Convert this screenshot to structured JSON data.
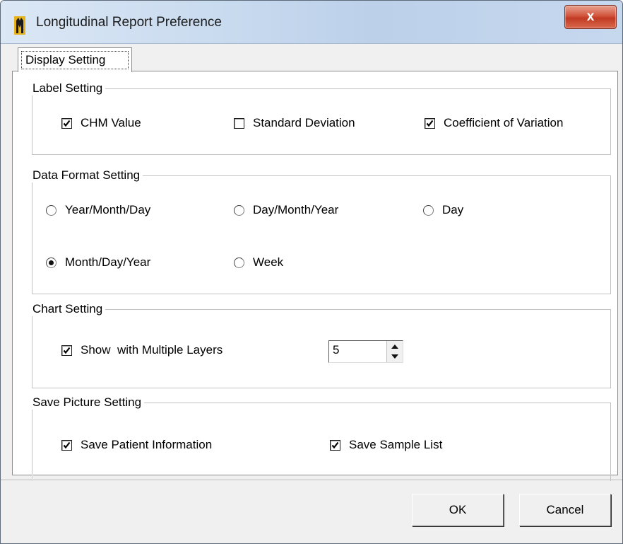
{
  "window": {
    "title": "Longitudinal Report Preference",
    "close_glyph": "x"
  },
  "tabs": [
    {
      "label": "Display Setting",
      "selected": true
    }
  ],
  "label_setting": {
    "title": "Label Setting",
    "options": [
      {
        "label": "CHM Value",
        "checked": true
      },
      {
        "label": "Standard Deviation",
        "checked": false
      },
      {
        "label": "Coefficient of Variation",
        "checked": true
      }
    ]
  },
  "data_format_setting": {
    "title": "Data Format Setting",
    "options": [
      {
        "label": "Year/Month/Day",
        "selected": false
      },
      {
        "label": "Day/Month/Year",
        "selected": false
      },
      {
        "label": "Day",
        "selected": false
      },
      {
        "label": "Month/Day/Year",
        "selected": true
      },
      {
        "label": "Week",
        "selected": false
      }
    ]
  },
  "chart_setting": {
    "title": "Chart Setting",
    "multiple_layers": {
      "label": "Show  with Multiple Layers",
      "checked": true
    },
    "layers_value": "5"
  },
  "save_picture_setting": {
    "title": "Save Picture Setting",
    "options": [
      {
        "label": "Save Patient Information",
        "checked": true
      },
      {
        "label": "Save Sample List",
        "checked": true
      }
    ]
  },
  "buttons": {
    "ok": "OK",
    "cancel": "Cancel"
  },
  "icons": {
    "app": "app-logo-icon",
    "close": "close-icon",
    "checkmark": "checkmark-icon",
    "spin_up": "arrow-up-icon",
    "spin_down": "arrow-down-icon"
  },
  "colors": {
    "close_button": "#c94a33",
    "titlebar": "#c9dbef",
    "dialog_bg": "#f0f0f0"
  }
}
